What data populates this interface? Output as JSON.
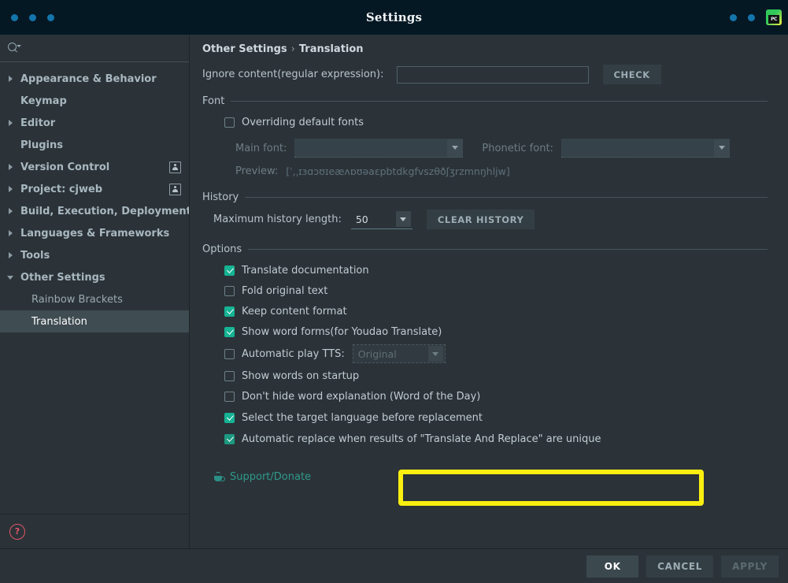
{
  "window": {
    "title": "Settings",
    "app_icon": "pycharm-logo-icon",
    "controls": [
      "close-dot",
      "minimize-dot",
      "maximize-dot"
    ]
  },
  "sidebar": {
    "search": {
      "value": "",
      "placeholder": ""
    },
    "items": [
      {
        "label": "Appearance & Behavior",
        "expander": "right",
        "indent": 0,
        "badge": false,
        "selected": false
      },
      {
        "label": "Keymap",
        "expander": "none",
        "indent": 0,
        "badge": false,
        "selected": false
      },
      {
        "label": "Editor",
        "expander": "right",
        "indent": 0,
        "badge": false,
        "selected": false
      },
      {
        "label": "Plugins",
        "expander": "none",
        "indent": 0,
        "badge": false,
        "selected": false
      },
      {
        "label": "Version Control",
        "expander": "right",
        "indent": 0,
        "badge": true,
        "selected": false
      },
      {
        "label": "Project: cjweb",
        "expander": "right",
        "indent": 0,
        "badge": true,
        "selected": false
      },
      {
        "label": "Build, Execution, Deployment",
        "expander": "right",
        "indent": 0,
        "badge": false,
        "selected": false
      },
      {
        "label": "Languages & Frameworks",
        "expander": "right",
        "indent": 0,
        "badge": false,
        "selected": false
      },
      {
        "label": "Tools",
        "expander": "right",
        "indent": 0,
        "badge": false,
        "selected": false
      },
      {
        "label": "Other Settings",
        "expander": "down",
        "indent": 0,
        "badge": false,
        "selected": false
      },
      {
        "label": "Rainbow Brackets",
        "expander": "none",
        "indent": 1,
        "badge": false,
        "selected": false
      },
      {
        "label": "Translation",
        "expander": "none",
        "indent": 1,
        "badge": false,
        "selected": true
      }
    ],
    "help_icon": "help-question-icon"
  },
  "breadcrumb": {
    "parent": "Other Settings",
    "separator": "›",
    "current": "Translation"
  },
  "ignore_content": {
    "label": "Ignore content(regular expression):",
    "value": "",
    "placeholder": "",
    "check_button": "CHECK"
  },
  "font_section": {
    "title": "Font",
    "overriding_label": "Overriding default fonts",
    "overriding_checked": false,
    "main_font_label": "Main font:",
    "main_font_value": "",
    "phonetic_font_label": "Phonetic font:",
    "phonetic_font_value": "",
    "preview_label": "Preview:",
    "preview_value": "[ˈ,ˌɪɜɑɔʊɪeæʌɒʊəaɛpbtdkgfvszθðʃʒrzmnŋhljw]"
  },
  "history_section": {
    "title": "History",
    "max_length_label": "Maximum history length:",
    "max_length_value": "50",
    "clear_button": "CLEAR HISTORY"
  },
  "options_section": {
    "title": "Options",
    "items": [
      {
        "label": "Translate documentation",
        "checked": true,
        "highlighted": false,
        "occluded": false
      },
      {
        "label": "Fold original text",
        "checked": false,
        "highlighted": false,
        "occluded": false
      },
      {
        "label": "Keep content format",
        "checked": true,
        "highlighted": false,
        "occluded": false
      },
      {
        "label": "Show word forms(for Youdao Translate)",
        "checked": true,
        "highlighted": false,
        "occluded": false
      },
      {
        "label": "Automatic play TTS:",
        "checked": false,
        "highlighted": false,
        "occluded": false,
        "combo_value": "Original",
        "combo_disabled": true
      },
      {
        "label": "Show words on startup",
        "checked": false,
        "highlighted": false,
        "occluded": false
      },
      {
        "label": "Don't hide word explanation (Word of the Day)",
        "checked": false,
        "highlighted": false,
        "occluded": true
      },
      {
        "label": "Select the target language before replacement",
        "checked": true,
        "highlighted": true,
        "occluded": false
      },
      {
        "label": "Automatic replace when results of \"Translate And Replace\" are unique",
        "checked": true,
        "highlighted": false,
        "occluded": false
      }
    ]
  },
  "support": {
    "icon": "coffee-cup-icon",
    "label": "Support/Donate"
  },
  "footer": {
    "ok": "OK",
    "cancel": "CANCEL",
    "apply": "APPLY"
  },
  "colors": {
    "accent_check": "#16b394",
    "highlight": "#fbee10",
    "titlebar": "#041824",
    "panel": "#2b3338",
    "selection": "#3f4c52",
    "link": "#2f9a8c",
    "help": "#e05569"
  }
}
